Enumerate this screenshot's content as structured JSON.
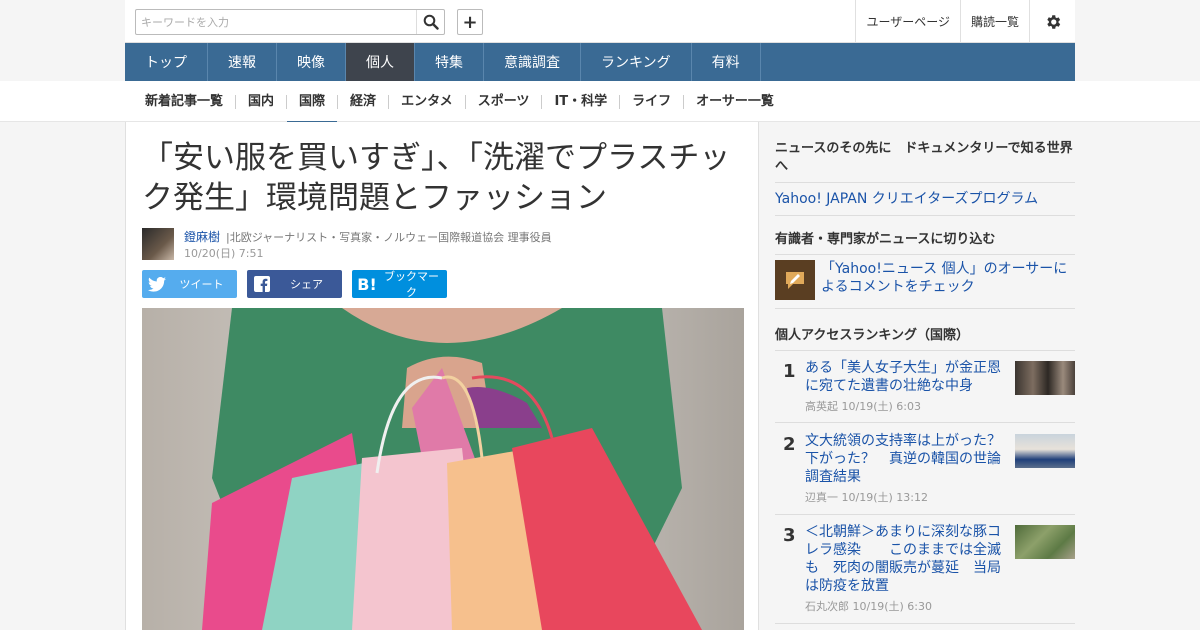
{
  "search": {
    "placeholder": "キーワードを入力"
  },
  "topbar": {
    "user_page": "ユーザーページ",
    "subscriptions": "購読一覧"
  },
  "mainnav": {
    "tabs": [
      "トップ",
      "速報",
      "映像",
      "個人",
      "特集",
      "意識調査",
      "ランキング",
      "有料"
    ],
    "active": "個人"
  },
  "subnav": {
    "items": [
      "新着記事一覧",
      "国内",
      "国際",
      "経済",
      "エンタメ",
      "スポーツ",
      "IT・科学",
      "ライフ",
      "オーサー一覧"
    ],
    "active": "国際"
  },
  "article": {
    "title": "「安い服を買いすぎ」、「洗濯でプラスチック発生」環境問題とファッション",
    "author_name": "鐙麻樹",
    "author_desc": "|北欧ジャーナリスト・写真家・ノルウェー国際報道協会 理事役員",
    "date": "10/20(日) 7:51",
    "share": {
      "tweet": "ツイート",
      "facebook": "シェア",
      "bookmark": "ブックマーク"
    }
  },
  "sidebar": {
    "promo_heading": "ニュースのその先に　ドキュメンタリーで知る世界へ",
    "promo_link": "Yahoo! JAPAN クリエイターズプログラム",
    "experts_heading": "有識者・専門家がニュースに切り込む",
    "experts_link": "「Yahoo!ニュース 個人」のオーサーによるコメントをチェック",
    "ranking_heading": "個人アクセスランキング（国際）",
    "ranking": [
      {
        "rank": "1",
        "title": "ある「美人女子大生」が金正恩に宛てた遺書の壮絶な中身",
        "author": "高英起",
        "date": "10/19(土) 6:03"
      },
      {
        "rank": "2",
        "title": "文大統領の支持率は上がった？下がった？　真逆の韓国の世論調査結果",
        "author": "辺真一",
        "date": "10/19(土) 13:12"
      },
      {
        "rank": "3",
        "title": "＜北朝鮮＞あまりに深刻な豚コレラ感染　　このままでは全滅も　死肉の闇販売が蔓延　当局は防疫を放置",
        "author": "石丸次郎",
        "date": "10/19(土) 6:30"
      }
    ]
  },
  "colors": {
    "nav": "#3a6a94",
    "nav_active": "#3e444d",
    "link": "#1a53a8",
    "twitter": "#55acee",
    "facebook": "#3b5998",
    "hatena": "#008fde"
  }
}
